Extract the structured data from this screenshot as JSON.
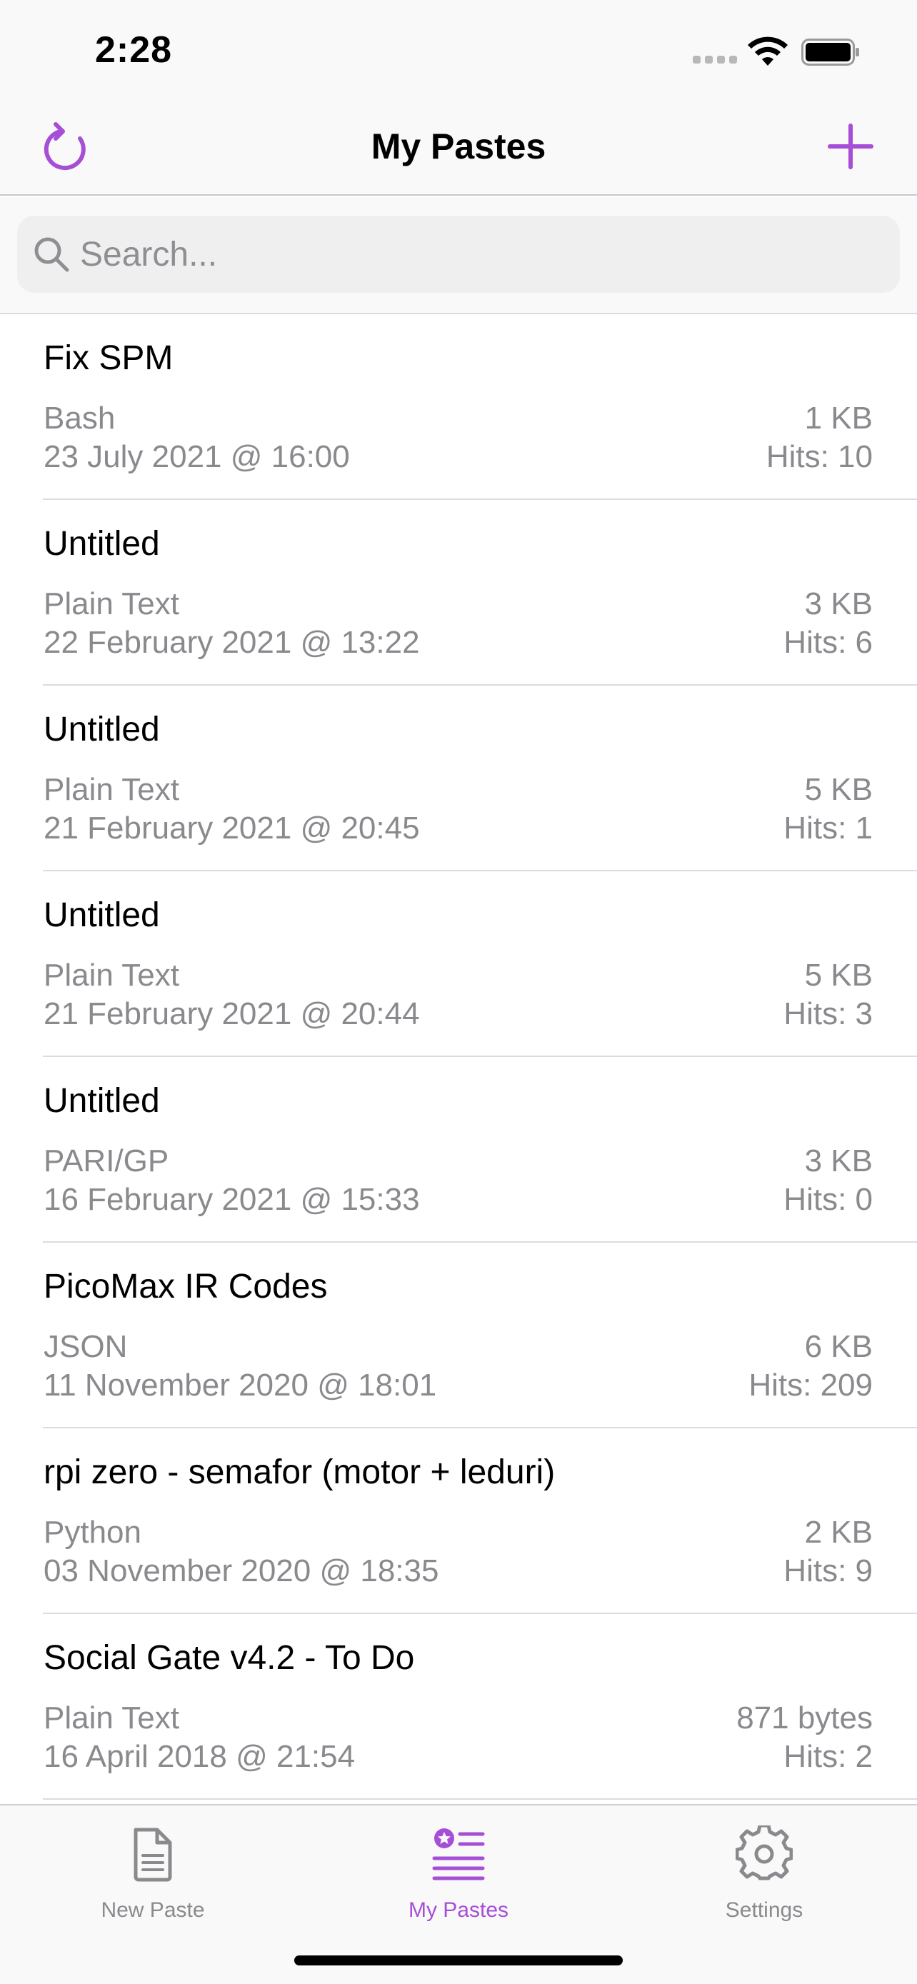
{
  "status_bar": {
    "time": "2:28"
  },
  "nav": {
    "title": "My Pastes",
    "refresh_icon": "refresh-icon",
    "add_icon": "plus-icon"
  },
  "search": {
    "placeholder": "Search...",
    "value": ""
  },
  "colors": {
    "accent": "#a64fd6",
    "secondary_text": "#8a8a8e",
    "separator": "#dcdce0",
    "bar_background": "#f9f9f9"
  },
  "pastes": [
    {
      "title": "Fix SPM",
      "language": "Bash",
      "date": "23 July 2021 @ 16:00",
      "size": "1 KB",
      "hits": "Hits: 10"
    },
    {
      "title": "Untitled",
      "language": "Plain Text",
      "date": "22 February 2021 @ 13:22",
      "size": "3 KB",
      "hits": "Hits: 6"
    },
    {
      "title": "Untitled",
      "language": "Plain Text",
      "date": "21 February 2021 @ 20:45",
      "size": "5 KB",
      "hits": "Hits: 1"
    },
    {
      "title": "Untitled",
      "language": "Plain Text",
      "date": "21 February 2021 @ 20:44",
      "size": "5 KB",
      "hits": "Hits: 3"
    },
    {
      "title": "Untitled",
      "language": "PARI/GP",
      "date": "16 February 2021 @ 15:33",
      "size": "3 KB",
      "hits": "Hits: 0"
    },
    {
      "title": "PicoMax IR Codes",
      "language": "JSON",
      "date": "11 November 2020 @ 18:01",
      "size": "6 KB",
      "hits": "Hits: 209"
    },
    {
      "title": "rpi zero - semafor (motor + leduri)",
      "language": "Python",
      "date": "03 November 2020 @ 18:35",
      "size": "2 KB",
      "hits": "Hits: 9"
    },
    {
      "title": "Social Gate v4.2 - To Do",
      "language": "Plain Text",
      "date": "16 April 2018 @ 21:54",
      "size": "871 bytes",
      "hits": "Hits: 2"
    }
  ],
  "tabs": [
    {
      "label": "New Paste",
      "icon": "document-icon",
      "active": false
    },
    {
      "label": "My Pastes",
      "icon": "starred-list-icon",
      "active": true
    },
    {
      "label": "Settings",
      "icon": "gear-icon",
      "active": false
    }
  ]
}
